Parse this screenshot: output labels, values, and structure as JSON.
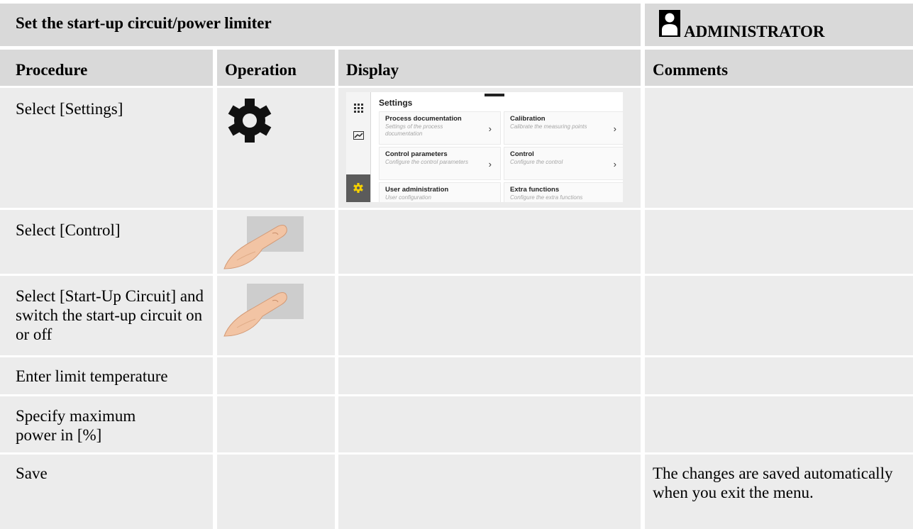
{
  "header": {
    "title": "Set the start-up circuit/power limiter",
    "role": "ADMINISTRATOR",
    "role_icon": "user-icon"
  },
  "columns": [
    "Procedure",
    "Operation",
    "Display",
    "Comments"
  ],
  "rows": [
    {
      "procedure": "Select [Settings]",
      "operation_icon": "gear-icon",
      "comment": ""
    },
    {
      "procedure": "Select [Control]",
      "operation_icon": "finger-tap-icon",
      "comment": ""
    },
    {
      "procedure": "Select [Start-Up Circuit] and switch the start-up circuit on or off",
      "operation_icon": "finger-tap-icon",
      "comment": ""
    },
    {
      "procedure": "Enter limit temperature",
      "comment": ""
    },
    {
      "procedure": "Specify maximum power in [%]",
      "comment": ""
    },
    {
      "procedure": "Save",
      "comment": "The changes are saved automatically when you exit the menu."
    }
  ],
  "settings_screen": {
    "title": "Settings",
    "tiles": [
      {
        "label": "Process documentation",
        "sub": "Settings of the process documentation"
      },
      {
        "label": "Calibration",
        "sub": "Calibrate the measuring points"
      },
      {
        "label": "Control parameters",
        "sub": "Configure the control parameters"
      },
      {
        "label": "Control",
        "sub": "Configure the control"
      },
      {
        "label": "User administration",
        "sub": "User configuration"
      },
      {
        "label": "Extra functions",
        "sub": "Configure the extra functions"
      }
    ],
    "rail_icons": [
      "apps-grid-icon",
      "chart-icon",
      "gear-icon"
    ],
    "accent_color": "#f5d000"
  }
}
